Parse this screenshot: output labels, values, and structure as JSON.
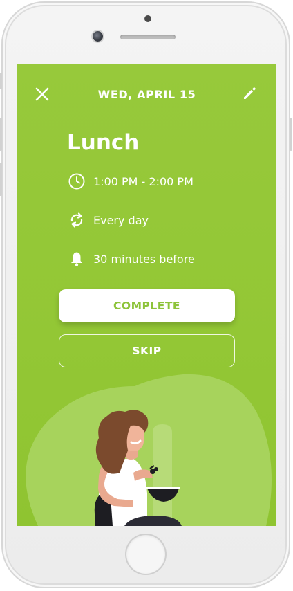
{
  "header": {
    "date": "WED,  APRIL 15",
    "close_icon": "close-icon",
    "edit_icon": "pencil-icon"
  },
  "event": {
    "title": "Lunch",
    "time": "1:00 PM - 2:00 PM",
    "repeat": "Every day",
    "reminder": "30 minutes before"
  },
  "actions": {
    "complete_label": "COMPLETE",
    "skip_label": "SKIP"
  },
  "colors": {
    "screen_bg": "#93c735",
    "accent_text": "#8dc33a",
    "white": "#ffffff"
  }
}
